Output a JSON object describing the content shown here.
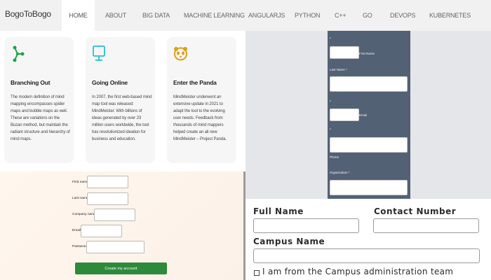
{
  "brand": "BogoToBogo",
  "nav": {
    "items": [
      "HOME",
      "ABOUT",
      "BIG DATA",
      "MACHINE LEARNING",
      "ANGULARJS",
      "PYTHON",
      "C++",
      "GO",
      "DEVOPS",
      "KUBERNETES"
    ],
    "active": "HOME"
  },
  "cards": [
    {
      "icon": "branch-icon",
      "title": "Branching Out",
      "body": "The modern definition of mind mapping encompasses spider maps and bubble maps as well. These are variations on the Buzan method, but maintain the radiant structure and hierarchy of mind maps."
    },
    {
      "icon": "monitor-icon",
      "title": "Going Online",
      "body": "In 2007, the first web-based mind map tool was released: MindMeister. With billions of ideas generated by over 23 million users worldwide, the tool has revolutionized ideation for business and education."
    },
    {
      "icon": "panda-icon",
      "title": "Enter the Panda",
      "body": "MindMeister underwent an extensive update in 2021 to adapt the tool to the evolving user needs. Feedback from thousands of mind mappers helped create an all new MindMeister – Project Panda."
    }
  ],
  "signup_form": {
    "fields": [
      {
        "label": "First name",
        "value": ""
      },
      {
        "label": "Last name",
        "value": ""
      },
      {
        "label": "Company name",
        "value": ""
      },
      {
        "label": "Email",
        "value": ""
      },
      {
        "label": "Password",
        "value": ""
      }
    ],
    "submit_label": "Create my account",
    "submit_color": "#2c8a3a"
  },
  "dark_form": {
    "background": "#536175",
    "dots": [
      "•",
      "•",
      "•",
      "•"
    ],
    "labels": {
      "first_name": "First Name",
      "last_name": "Last Name *",
      "email": "Email",
      "phone": "Phone",
      "organization": "Organization *"
    }
  },
  "contact_form": {
    "full_name_label": "Full Name",
    "contact_number_label": "Contact Number",
    "campus_name_label": "Campus Name",
    "checkbox_label": "I am from the Campus administration team",
    "checkbox_checked": false
  }
}
